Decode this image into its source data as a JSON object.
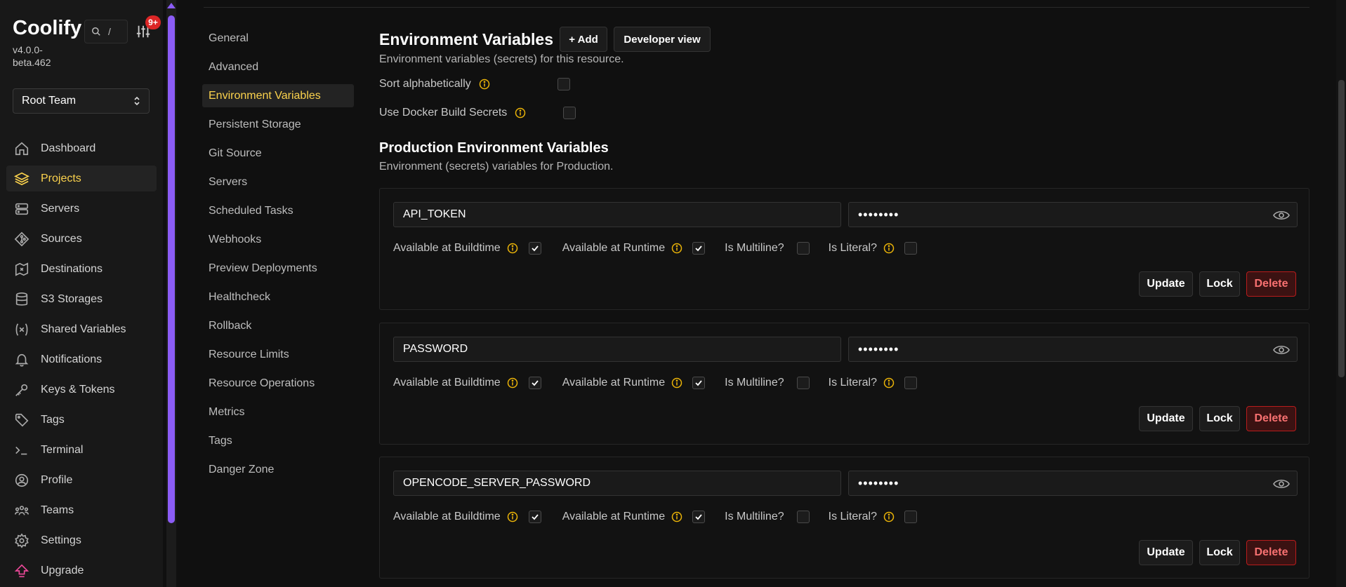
{
  "sidebar": {
    "brand": "Coolify",
    "version": "v4.0.0-beta.462",
    "search_shortcut": "/",
    "notification_badge": "9+",
    "team": "Root Team",
    "items": [
      {
        "label": "Dashboard",
        "icon": "home-icon"
      },
      {
        "label": "Projects",
        "icon": "layers-icon",
        "active": true
      },
      {
        "label": "Servers",
        "icon": "server-icon"
      },
      {
        "label": "Sources",
        "icon": "git-icon"
      },
      {
        "label": "Destinations",
        "icon": "map-icon"
      },
      {
        "label": "S3 Storages",
        "icon": "database-icon"
      },
      {
        "label": "Shared Variables",
        "icon": "variable-icon"
      },
      {
        "label": "Notifications",
        "icon": "bell-icon"
      },
      {
        "label": "Keys & Tokens",
        "icon": "key-icon"
      },
      {
        "label": "Tags",
        "icon": "tag-icon"
      },
      {
        "label": "Terminal",
        "icon": "terminal-icon"
      },
      {
        "label": "Profile",
        "icon": "user-icon"
      },
      {
        "label": "Teams",
        "icon": "users-icon"
      },
      {
        "label": "Settings",
        "icon": "gear-icon"
      }
    ],
    "upgrade": "Upgrade"
  },
  "subnav": {
    "items": [
      {
        "label": "General"
      },
      {
        "label": "Advanced"
      },
      {
        "label": "Environment Variables",
        "active": true
      },
      {
        "label": "Persistent Storage"
      },
      {
        "label": "Git Source"
      },
      {
        "label": "Servers"
      },
      {
        "label": "Scheduled Tasks"
      },
      {
        "label": "Webhooks"
      },
      {
        "label": "Preview Deployments"
      },
      {
        "label": "Healthcheck"
      },
      {
        "label": "Rollback"
      },
      {
        "label": "Resource Limits"
      },
      {
        "label": "Resource Operations"
      },
      {
        "label": "Metrics"
      },
      {
        "label": "Tags"
      },
      {
        "label": "Danger Zone"
      }
    ]
  },
  "main": {
    "title": "Environment Variables",
    "add_label": "+ Add",
    "developer_view_label": "Developer view",
    "description": "Environment variables (secrets) for this resource.",
    "sort_label": "Sort alphabetically",
    "docker_secrets_label": "Use Docker Build Secrets",
    "production_title": "Production Environment Variables",
    "production_description": "Environment (secrets) variables for Production.",
    "flag_buildtime": "Available at Buildtime",
    "flag_runtime": "Available at Runtime",
    "flag_multiline": "Is Multiline?",
    "flag_literal": "Is Literal?",
    "update_label": "Update",
    "lock_label": "Lock",
    "delete_label": "Delete",
    "variables": [
      {
        "key": "API_TOKEN",
        "value": "••••••••",
        "buildtime": true,
        "runtime": true,
        "multiline": false,
        "literal": false
      },
      {
        "key": "PASSWORD",
        "value": "••••••••",
        "buildtime": true,
        "runtime": true,
        "multiline": false,
        "literal": false
      },
      {
        "key": "OPENCODE_SERVER_PASSWORD",
        "value": "••••••••",
        "buildtime": true,
        "runtime": true,
        "multiline": false,
        "literal": false
      }
    ]
  },
  "colors": {
    "accent": "#fcd34d",
    "scroll_thumb": "#8b5cf6",
    "danger": "#b91c1c",
    "info": "#eab308"
  }
}
